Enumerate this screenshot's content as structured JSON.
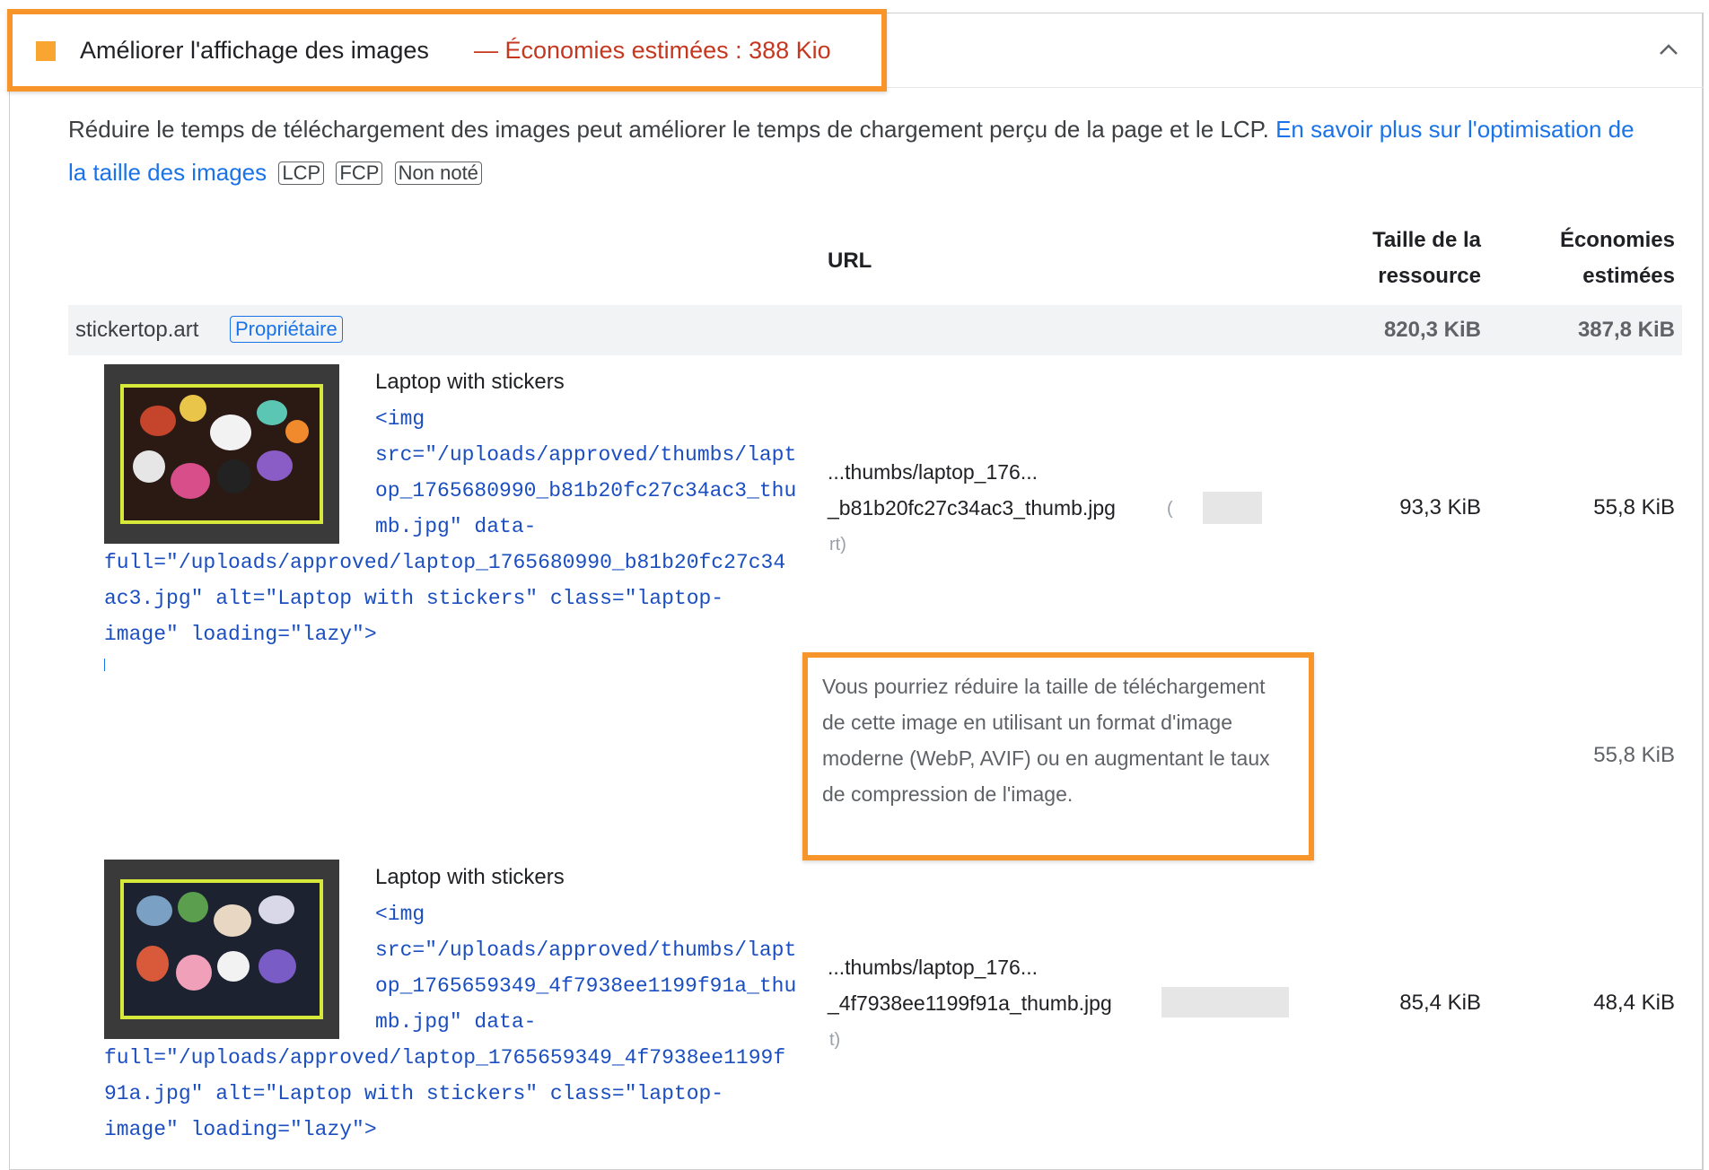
{
  "audit": {
    "title": "Améliorer l'affichage des images",
    "savings": "— Économies estimées : 388 Kio",
    "status_color": "#f8a531",
    "description": "Réduire le temps de téléchargement des images peut améliorer le temps de chargement perçu de la page et le LCP.",
    "learn_more": "En savoir plus sur l'optimisation de la taille des images",
    "tags": [
      "LCP",
      "FCP",
      "Non noté"
    ]
  },
  "table": {
    "headers": {
      "url": "URL",
      "size_line1": "Taille de la",
      "size_line2": "ressource",
      "savings_line1": "Économies",
      "savings_line2": "estimées"
    },
    "group": {
      "origin": "stickertop.art",
      "owner_badge": "Propriétaire",
      "size": "820,3 KiB",
      "savings": "387,8 KiB"
    },
    "rows": [
      {
        "node_label": "Laptop with stickers",
        "snippet_lines": [
          "<img",
          "src=\"/uploads/approved/thumbs/lapt",
          "op_1765680990_b81b20fc27c34ac3_thu",
          "mb.jpg\" data-",
          "full=\"/uploads/approved/laptop_1765680990_b81b20fc27c34",
          "ac3.jpg\" alt=\"Laptop with stickers\" class=\"laptop-",
          "image\" loading=\"lazy\">"
        ],
        "url_line1": "...thumbs/laptop_176...",
        "url_line2": "_b81b20fc27c34ac3_thumb.jpg",
        "url_paren": "(",
        "url_sub": "rt)",
        "size": "93,3 KiB",
        "savings": "55,8 KiB"
      },
      {
        "node_label": "Laptop with stickers",
        "snippet_lines": [
          "<img",
          "src=\"/uploads/approved/thumbs/lapt",
          "op_1765659349_4f7938ee1199f91a_thu",
          "mb.jpg\" data-",
          "full=\"/uploads/approved/laptop_1765659349_4f7938ee1199f",
          "91a.jpg\" alt=\"Laptop with stickers\" class=\"laptop-",
          "image\" loading=\"lazy\">"
        ],
        "url_line1": "...thumbs/laptop_176...",
        "url_line2": "_4f7938ee1199f91a_thumb.jpg",
        "url_sub": "t)",
        "size": "85,4 KiB",
        "savings": "48,4 KiB"
      }
    ],
    "subitem": {
      "text": "Vous pourriez réduire la taille de téléchargement de cette image en utilisant un format d'image moderne (WebP, AVIF) ou en augmentant le taux de compression de l'image.",
      "savings": "55,8 KiB"
    }
  }
}
